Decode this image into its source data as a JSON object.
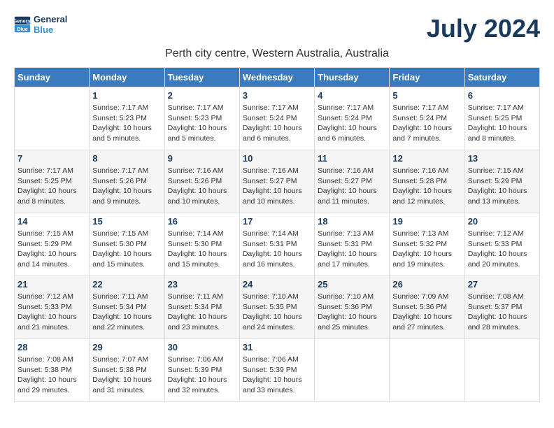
{
  "app": {
    "logo_line1": "General",
    "logo_line2": "Blue",
    "title": "July 2024",
    "location": "Perth city centre, Western Australia, Australia"
  },
  "calendar": {
    "headers": [
      "Sunday",
      "Monday",
      "Tuesday",
      "Wednesday",
      "Thursday",
      "Friday",
      "Saturday"
    ],
    "weeks": [
      [
        {
          "day": "",
          "info": ""
        },
        {
          "day": "1",
          "info": "Sunrise: 7:17 AM\nSunset: 5:23 PM\nDaylight: 10 hours\nand 5 minutes."
        },
        {
          "day": "2",
          "info": "Sunrise: 7:17 AM\nSunset: 5:23 PM\nDaylight: 10 hours\nand 5 minutes."
        },
        {
          "day": "3",
          "info": "Sunrise: 7:17 AM\nSunset: 5:24 PM\nDaylight: 10 hours\nand 6 minutes."
        },
        {
          "day": "4",
          "info": "Sunrise: 7:17 AM\nSunset: 5:24 PM\nDaylight: 10 hours\nand 6 minutes."
        },
        {
          "day": "5",
          "info": "Sunrise: 7:17 AM\nSunset: 5:24 PM\nDaylight: 10 hours\nand 7 minutes."
        },
        {
          "day": "6",
          "info": "Sunrise: 7:17 AM\nSunset: 5:25 PM\nDaylight: 10 hours\nand 8 minutes."
        }
      ],
      [
        {
          "day": "7",
          "info": "Sunrise: 7:17 AM\nSunset: 5:25 PM\nDaylight: 10 hours\nand 8 minutes."
        },
        {
          "day": "8",
          "info": "Sunrise: 7:17 AM\nSunset: 5:26 PM\nDaylight: 10 hours\nand 9 minutes."
        },
        {
          "day": "9",
          "info": "Sunrise: 7:16 AM\nSunset: 5:26 PM\nDaylight: 10 hours\nand 10 minutes."
        },
        {
          "day": "10",
          "info": "Sunrise: 7:16 AM\nSunset: 5:27 PM\nDaylight: 10 hours\nand 10 minutes."
        },
        {
          "day": "11",
          "info": "Sunrise: 7:16 AM\nSunset: 5:27 PM\nDaylight: 10 hours\nand 11 minutes."
        },
        {
          "day": "12",
          "info": "Sunrise: 7:16 AM\nSunset: 5:28 PM\nDaylight: 10 hours\nand 12 minutes."
        },
        {
          "day": "13",
          "info": "Sunrise: 7:15 AM\nSunset: 5:29 PM\nDaylight: 10 hours\nand 13 minutes."
        }
      ],
      [
        {
          "day": "14",
          "info": "Sunrise: 7:15 AM\nSunset: 5:29 PM\nDaylight: 10 hours\nand 14 minutes."
        },
        {
          "day": "15",
          "info": "Sunrise: 7:15 AM\nSunset: 5:30 PM\nDaylight: 10 hours\nand 15 minutes."
        },
        {
          "day": "16",
          "info": "Sunrise: 7:14 AM\nSunset: 5:30 PM\nDaylight: 10 hours\nand 15 minutes."
        },
        {
          "day": "17",
          "info": "Sunrise: 7:14 AM\nSunset: 5:31 PM\nDaylight: 10 hours\nand 16 minutes."
        },
        {
          "day": "18",
          "info": "Sunrise: 7:13 AM\nSunset: 5:31 PM\nDaylight: 10 hours\nand 17 minutes."
        },
        {
          "day": "19",
          "info": "Sunrise: 7:13 AM\nSunset: 5:32 PM\nDaylight: 10 hours\nand 19 minutes."
        },
        {
          "day": "20",
          "info": "Sunrise: 7:12 AM\nSunset: 5:33 PM\nDaylight: 10 hours\nand 20 minutes."
        }
      ],
      [
        {
          "day": "21",
          "info": "Sunrise: 7:12 AM\nSunset: 5:33 PM\nDaylight: 10 hours\nand 21 minutes."
        },
        {
          "day": "22",
          "info": "Sunrise: 7:11 AM\nSunset: 5:34 PM\nDaylight: 10 hours\nand 22 minutes."
        },
        {
          "day": "23",
          "info": "Sunrise: 7:11 AM\nSunset: 5:34 PM\nDaylight: 10 hours\nand 23 minutes."
        },
        {
          "day": "24",
          "info": "Sunrise: 7:10 AM\nSunset: 5:35 PM\nDaylight: 10 hours\nand 24 minutes."
        },
        {
          "day": "25",
          "info": "Sunrise: 7:10 AM\nSunset: 5:36 PM\nDaylight: 10 hours\nand 25 minutes."
        },
        {
          "day": "26",
          "info": "Sunrise: 7:09 AM\nSunset: 5:36 PM\nDaylight: 10 hours\nand 27 minutes."
        },
        {
          "day": "27",
          "info": "Sunrise: 7:08 AM\nSunset: 5:37 PM\nDaylight: 10 hours\nand 28 minutes."
        }
      ],
      [
        {
          "day": "28",
          "info": "Sunrise: 7:08 AM\nSunset: 5:38 PM\nDaylight: 10 hours\nand 29 minutes."
        },
        {
          "day": "29",
          "info": "Sunrise: 7:07 AM\nSunset: 5:38 PM\nDaylight: 10 hours\nand 31 minutes."
        },
        {
          "day": "30",
          "info": "Sunrise: 7:06 AM\nSunset: 5:39 PM\nDaylight: 10 hours\nand 32 minutes."
        },
        {
          "day": "31",
          "info": "Sunrise: 7:06 AM\nSunset: 5:39 PM\nDaylight: 10 hours\nand 33 minutes."
        },
        {
          "day": "",
          "info": ""
        },
        {
          "day": "",
          "info": ""
        },
        {
          "day": "",
          "info": ""
        }
      ]
    ]
  }
}
